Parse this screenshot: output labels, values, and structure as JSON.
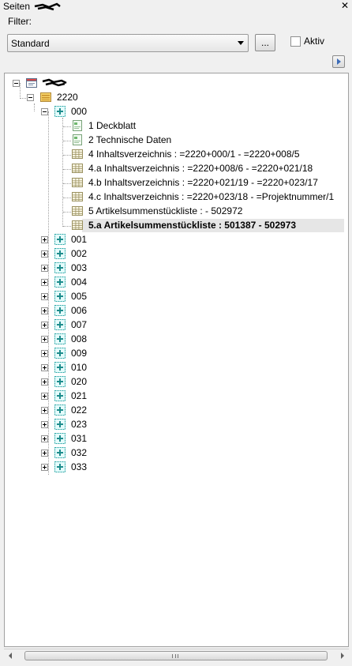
{
  "window": {
    "title": "Seiten",
    "close_glyph": "✕"
  },
  "filter": {
    "label": "Filter:",
    "selected": "Standard",
    "dots_label": "...",
    "active_label": "Aktiv",
    "active_checked": false
  },
  "tree": {
    "root": {
      "label": "",
      "icon": "project-icon"
    },
    "node_2220": {
      "label": "2220",
      "icon": "folder-icon"
    },
    "node_000": {
      "label": "000",
      "icon": "structure-icon"
    },
    "pages": [
      {
        "label": "1 Deckblatt",
        "icon": "page-doc-icon",
        "selected": false
      },
      {
        "label": "2 Technische Daten",
        "icon": "page-doc-icon",
        "selected": false
      },
      {
        "label": "4 Inhaltsverzeichnis : =2220+000/1 - =2220+008/5",
        "icon": "page-table-icon",
        "selected": false
      },
      {
        "label": "4.a Inhaltsverzeichnis : =2220+008/6 - =2220+021/18",
        "icon": "page-table-icon",
        "selected": false
      },
      {
        "label": "4.b Inhaltsverzeichnis : =2220+021/19 - =2220+023/17",
        "icon": "page-table-icon",
        "selected": false
      },
      {
        "label": "4.c Inhaltsverzeichnis : =2220+023/18 - =Projektnummer/1",
        "icon": "page-table-icon",
        "selected": false
      },
      {
        "label": "5 Artikelsummenstückliste :  - 502972",
        "icon": "page-table-icon",
        "selected": false
      },
      {
        "label": "5.a Artikelsummenstückliste : 501387 - 502973",
        "icon": "page-table-icon",
        "selected": true
      }
    ],
    "groups": [
      "001",
      "002",
      "003",
      "004",
      "005",
      "006",
      "007",
      "008",
      "009",
      "010",
      "020",
      "021",
      "022",
      "023",
      "031",
      "032",
      "033"
    ]
  },
  "colors": {
    "selection": "#e6e6e6",
    "tree_bg": "#ffffff",
    "panel_bg": "#f0f0f0"
  }
}
